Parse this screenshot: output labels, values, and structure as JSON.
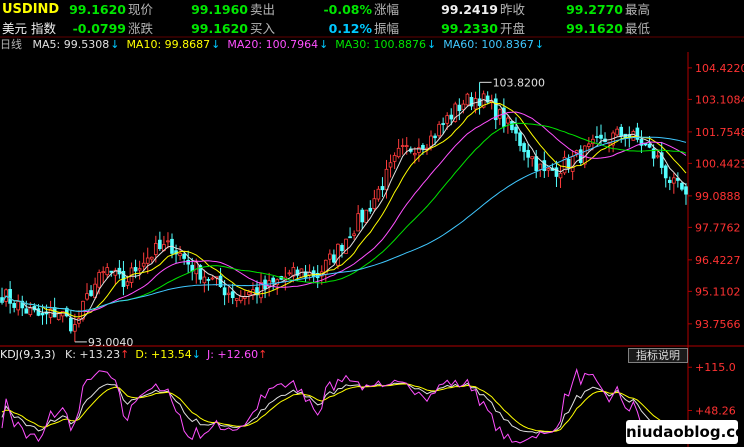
{
  "quote": {
    "symbol": "USDIND",
    "name": "美元 指数",
    "row1": [
      {
        "label": "现价",
        "value": "99.1620",
        "color": "#00e600"
      },
      {
        "label": "卖出",
        "value": "99.1960",
        "color": "#00e600"
      },
      {
        "label": "涨幅",
        "value": "-0.08%",
        "color": "#00e600"
      },
      {
        "label": "昨收",
        "value": "99.2419",
        "color": "#f0f0f0"
      },
      {
        "label": "最高",
        "value": "99.2770",
        "color": "#00e600"
      }
    ],
    "row2": [
      {
        "label": "涨跌",
        "value": "-0.0799",
        "color": "#00e600"
      },
      {
        "label": "买入",
        "value": "99.1620",
        "color": "#00e600"
      },
      {
        "label": "振幅",
        "value": "0.12%",
        "color": "#00c8ff"
      },
      {
        "label": "开盘",
        "value": "99.2330",
        "color": "#00e600"
      },
      {
        "label": "最低",
        "value": "99.1620",
        "color": "#00e600"
      }
    ]
  },
  "ma_legend": {
    "period": "日线",
    "items": [
      {
        "text": "MA5: 99.5308",
        "color": "#e0e0e0"
      },
      {
        "text": "MA10: 99.8687",
        "color": "#ffff00"
      },
      {
        "text": "MA20: 100.7964",
        "color": "#ff50ff"
      },
      {
        "text": "MA30: 100.8876",
        "color": "#00e600"
      },
      {
        "text": "MA60: 100.8367",
        "color": "#40c8ff"
      }
    ],
    "arrow": "↓"
  },
  "kdj_legend": {
    "title": "KDJ(9,3,3)",
    "items": [
      {
        "text": "K: +13.23",
        "color": "#e0e0e0",
        "arrow": "↑",
        "arrow_color": "#ff3232"
      },
      {
        "text": "D: +13.54",
        "color": "#ffff00",
        "arrow": "↓",
        "arrow_color": "#00c8ff"
      },
      {
        "text": "J: +12.60",
        "color": "#ff50ff",
        "arrow": "↑",
        "arrow_color": "#ff3232"
      }
    ],
    "button": "指标说明"
  },
  "chart_data": {
    "type": "candlestick",
    "price_axis_ticks": [
      "104.4220",
      "103.1084",
      "101.7548",
      "100.4423",
      "99.0888",
      "97.7762",
      "96.4227",
      "95.1102",
      "93.7566"
    ],
    "price_axis_values": [
      104.422,
      103.1084,
      101.7548,
      100.4423,
      99.0888,
      97.7762,
      96.4227,
      95.1102,
      93.7566
    ],
    "price_range": [
      93.0,
      105.0
    ],
    "annotations": [
      {
        "text": "103.8200",
        "value": 103.82,
        "bar": 118
      },
      {
        "text": "93.0040",
        "value": 93.004,
        "bar": 18
      }
    ],
    "close_path": [
      [
        0,
        95.0
      ],
      [
        5,
        94.4
      ],
      [
        10,
        94.0
      ],
      [
        14,
        94.3
      ],
      [
        18,
        93.6
      ],
      [
        22,
        95.2
      ],
      [
        26,
        96.0
      ],
      [
        30,
        95.4
      ],
      [
        34,
        96.3
      ],
      [
        38,
        96.8
      ],
      [
        42,
        97.0
      ],
      [
        46,
        96.3
      ],
      [
        50,
        95.8
      ],
      [
        54,
        95.3
      ],
      [
        58,
        94.9
      ],
      [
        62,
        95.1
      ],
      [
        66,
        95.3
      ],
      [
        70,
        95.7
      ],
      [
        74,
        95.9
      ],
      [
        78,
        95.8
      ],
      [
        82,
        96.6
      ],
      [
        86,
        97.6
      ],
      [
        90,
        98.4
      ],
      [
        94,
        99.6
      ],
      [
        98,
        100.8
      ],
      [
        102,
        101.2
      ],
      [
        106,
        101.5
      ],
      [
        110,
        102.3
      ],
      [
        114,
        103.0
      ],
      [
        118,
        103.2
      ],
      [
        122,
        102.6
      ],
      [
        126,
        101.8
      ],
      [
        130,
        100.9
      ],
      [
        134,
        100.0
      ],
      [
        138,
        100.3
      ],
      [
        142,
        100.7
      ],
      [
        146,
        101.1
      ],
      [
        150,
        101.5
      ],
      [
        154,
        101.7
      ],
      [
        158,
        101.3
      ],
      [
        162,
        100.6
      ],
      [
        166,
        99.5
      ],
      [
        169,
        99.16
      ]
    ],
    "ma_colors": [
      "#e0e0e0",
      "#ffff00",
      "#ff50ff",
      "#00e600",
      "#40c8ff"
    ],
    "ma_periods": [
      5,
      10,
      20,
      30,
      60
    ],
    "kdj_axis_ticks": [
      "+115.0",
      "+48.26"
    ],
    "kdj_axis_values": [
      115.0,
      48.26
    ],
    "kdj_range": [
      -5,
      120
    ]
  },
  "watermark": "niudaoblog.com"
}
